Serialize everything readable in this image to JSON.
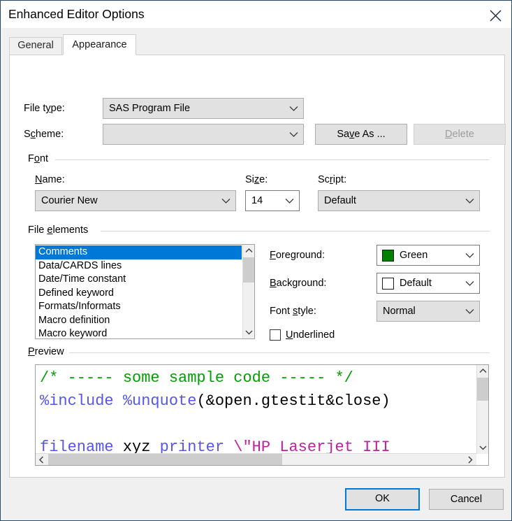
{
  "window": {
    "title": "Enhanced Editor Options",
    "close_icon": "close-icon"
  },
  "tabs": [
    {
      "label": "General",
      "active": false
    },
    {
      "label": "Appearance",
      "active": true
    }
  ],
  "form": {
    "file_type_label": "File type:",
    "file_type_value": "SAS Program File",
    "scheme_label": "Scheme:",
    "scheme_value": "",
    "save_as_label": "Save As ...",
    "delete_label": "Delete",
    "delete_disabled": true
  },
  "font_group": {
    "title": "Font",
    "name_label": "Name:",
    "name_value": "Courier New",
    "size_label": "Size:",
    "size_value": "14",
    "script_label": "Script:",
    "script_value": "Default"
  },
  "file_elements": {
    "title": "File elements",
    "items": [
      "Comments",
      "Data/CARDS lines",
      "Date/Time constant",
      "Defined keyword",
      "Formats/Informats",
      "Macro definition",
      "Macro keyword"
    ],
    "selected_index": 0
  },
  "element_props": {
    "foreground_label": "Foreground:",
    "foreground_value": "Green",
    "foreground_color": "#008000",
    "background_label": "Background:",
    "background_value": "Default",
    "background_color": "#ffffff",
    "font_style_label": "Font style:",
    "font_style_value": "Normal",
    "underlined_label": "Underlined",
    "underlined_checked": false
  },
  "preview": {
    "title": "Preview",
    "lines": [
      {
        "tokens": [
          {
            "text": "/* ----- some sample code ----- */",
            "color": "#00a000"
          }
        ]
      },
      {
        "tokens": [
          {
            "text": "%include %unquote",
            "color": "#5555ee"
          },
          {
            "text": "(&open.gtestit&close)",
            "color": "#000000"
          }
        ]
      },
      {
        "tokens": [
          {
            "text": "",
            "color": "#000000"
          }
        ]
      },
      {
        "tokens": [
          {
            "text": "filename ",
            "color": "#5555ee"
          },
          {
            "text": "xyz ",
            "color": "#000000"
          },
          {
            "text": "printer ",
            "color": "#5555ee"
          },
          {
            "text": "\\\"HP Laserjet III",
            "color": "#c020a0"
          }
        ]
      }
    ]
  },
  "footer": {
    "ok_label": "OK",
    "cancel_label": "Cancel"
  },
  "colors": {
    "accent": "#0078d7",
    "selection": "#0078d7",
    "dialog_bg": "#f0f0f0",
    "page_bg": "#ffffff"
  }
}
